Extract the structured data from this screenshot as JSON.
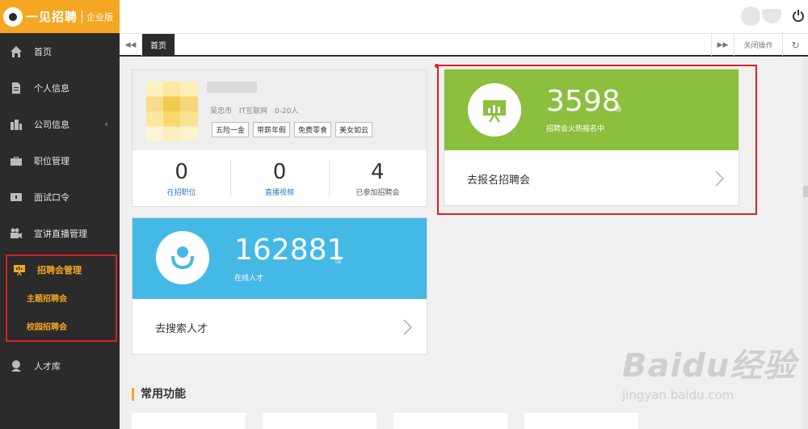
{
  "brand": {
    "name": "一见招聘",
    "edition": "企业版"
  },
  "sidebar": {
    "items": [
      {
        "label": "首页",
        "icon": "home-icon"
      },
      {
        "label": "个人信息",
        "icon": "document-icon"
      },
      {
        "label": "公司信息",
        "icon": "building-icon",
        "arrow": "‹"
      },
      {
        "label": "职位管理",
        "icon": "briefcase-icon"
      },
      {
        "label": "面试口令",
        "icon": "key-card-icon"
      },
      {
        "label": "宣讲直播管理",
        "icon": "video-camera-icon"
      }
    ],
    "fair_group": {
      "label": "招聘会管理",
      "icon": "presentation-icon",
      "subitems": [
        "主题招聘会",
        "校园招聘会"
      ]
    },
    "after": [
      {
        "label": "人才库",
        "icon": "talent-pool-icon"
      }
    ]
  },
  "tabbar": {
    "home_tab": "首页",
    "close_ops": "关闭操作"
  },
  "profile": {
    "meta": "吴忠市 IT互联网 0-20人",
    "tags": [
      "五险一金",
      "带薪年假",
      "免费零食",
      "美女如云"
    ],
    "stats": [
      {
        "value": "0",
        "label": "在招职位"
      },
      {
        "value": "0",
        "label": "直播视频"
      },
      {
        "value": "4",
        "label": "已参加招聘会"
      }
    ]
  },
  "fair_card": {
    "count": "3598",
    "unit": "场",
    "sub": "招聘会火热报名中",
    "action": "去报名招聘会",
    "color": "#8cbf3d"
  },
  "talent_card": {
    "count": "162881",
    "unit": "位",
    "sub": "在线人才",
    "action": "去搜索人才",
    "color": "#45b9e6"
  },
  "section": {
    "title": "常用功能"
  },
  "watermark": {
    "main": "Baidu经验",
    "sub": "jingyan.baidu.com"
  },
  "colors": {
    "accent": "#f5a623",
    "sidebar": "#2b2b2b",
    "annotation": "#e02020"
  }
}
